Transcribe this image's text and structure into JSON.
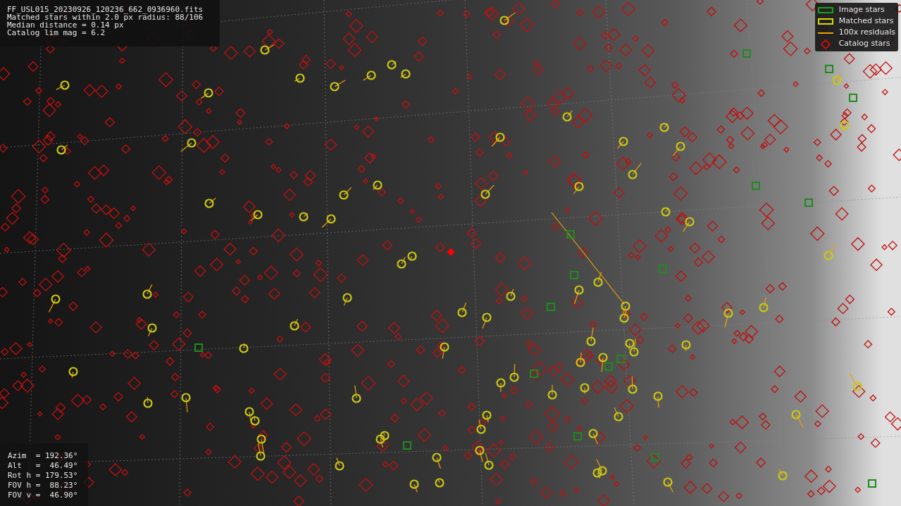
{
  "header": {
    "lines": [
      "FF_USL015_20230926_120236_662_0936960.fits",
      "Matched stars within 2.0 px radius: 88/106",
      "Median distance = 0.14 px",
      "Catalog lim mag = 6.2"
    ]
  },
  "legend": [
    {
      "label": "Image stars",
      "kind": "box",
      "color": "#1aa01a"
    },
    {
      "label": "Matched stars",
      "kind": "box",
      "color": "#d8d800"
    },
    {
      "label": "100x residuals",
      "kind": "line",
      "color": "#f0a000"
    },
    {
      "label": "Catalog stars",
      "kind": "diamond",
      "color": "#c01010"
    }
  ],
  "pointing": {
    "lines": [
      "Azim  = 192.36°",
      "Alt   =  46.49°",
      "Rot h = 179.53°",
      "FOV h =  88.23°",
      "FOV v =  46.90°"
    ]
  }
}
